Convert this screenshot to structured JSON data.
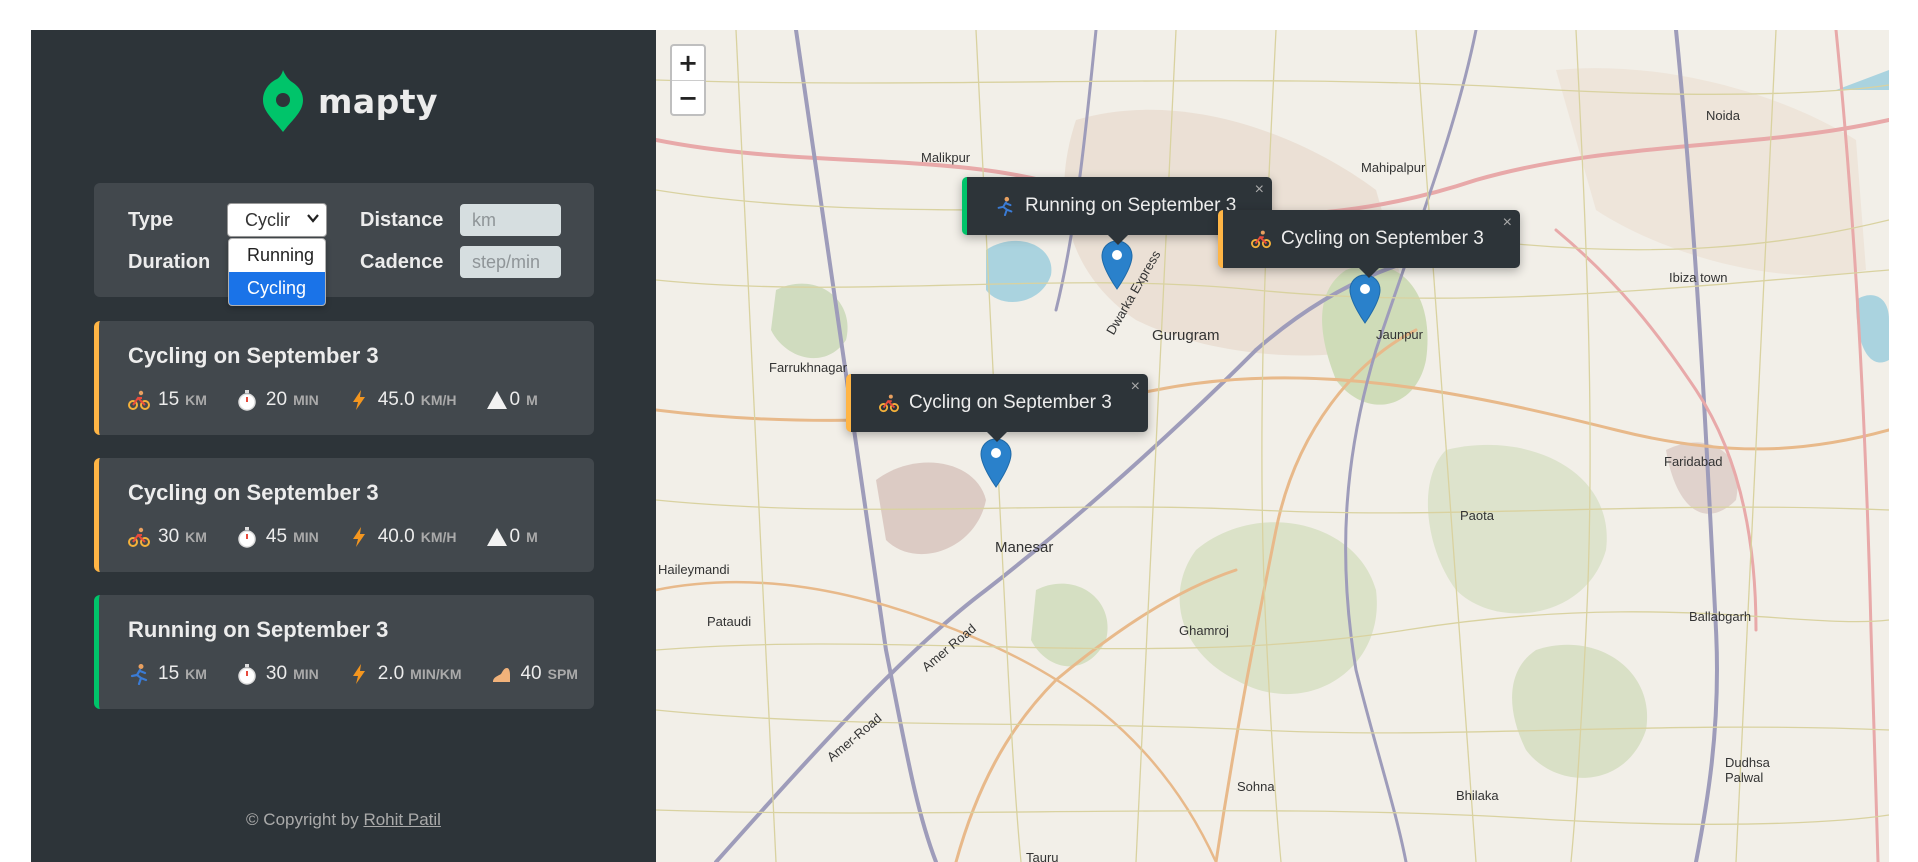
{
  "app": {
    "name": "mapty"
  },
  "form": {
    "type_label": "Type",
    "type_value": "Cyclir",
    "type_options": [
      "Running",
      "Cycling"
    ],
    "type_selected": "Cycling",
    "distance_label": "Distance",
    "distance_placeholder": "km",
    "duration_label": "Duration",
    "cadence_label": "Cadence",
    "cadence_placeholder": "step/min"
  },
  "workouts": [
    {
      "type": "cycling",
      "title": "Cycling on September 3",
      "distance": "15",
      "distance_unit": "km",
      "duration": "20",
      "duration_unit": "min",
      "speed": "45.0",
      "speed_unit": "km/h",
      "elevation": "0",
      "elevation_unit": "m"
    },
    {
      "type": "cycling",
      "title": "Cycling on September 3",
      "distance": "30",
      "distance_unit": "km",
      "duration": "45",
      "duration_unit": "min",
      "speed": "40.0",
      "speed_unit": "km/h",
      "elevation": "0",
      "elevation_unit": "m"
    },
    {
      "type": "running",
      "title": "Running on September 3",
      "distance": "15",
      "distance_unit": "km",
      "duration": "30",
      "duration_unit": "min",
      "pace": "2.0",
      "pace_unit": "min/km",
      "cadence": "40",
      "cadence_unit": "spm"
    }
  ],
  "footer": {
    "prefix": "© Copyright by ",
    "author": "Rohit Patil"
  },
  "map": {
    "zoom_in": "+",
    "zoom_out": "−",
    "popups": [
      {
        "type": "running",
        "text": "Running on September 3",
        "close": "×"
      },
      {
        "type": "cycling",
        "text": "Cycling on September 3",
        "close": "×"
      },
      {
        "type": "cycling",
        "text": "Cycling on September 3",
        "close": "×"
      }
    ],
    "places": [
      "Noida",
      "Malikpur",
      "Mahipalpur",
      "Gurugram",
      "Jaunpur",
      "Farrukhnagar",
      "Faridabad",
      "Manesar",
      "Haileymandi",
      "Pataudi",
      "Ghamroj",
      "Paota",
      "Ballabgarh",
      "Sohna",
      "Bhilaka",
      "Dudhsa Palwal",
      "Tauru",
      "Ibiza town",
      "Amer Road",
      "Amer-Road",
      "Dwarka Express"
    ]
  },
  "colors": {
    "sidebar": "#2d3439",
    "panel": "#42484d",
    "cycling": "#ffb545",
    "running": "#00c46a",
    "text": "#ececec"
  }
}
